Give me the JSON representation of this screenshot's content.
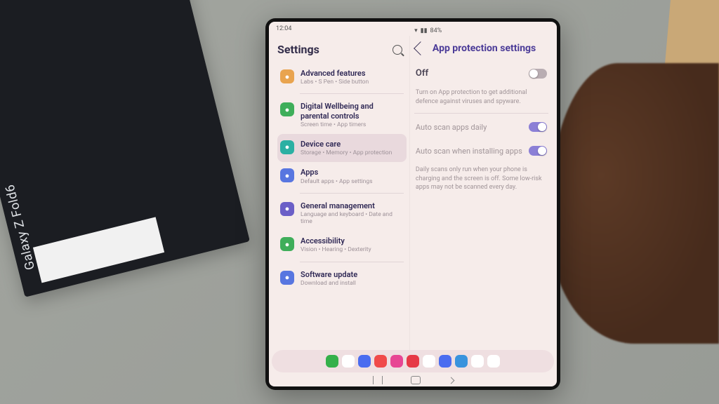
{
  "device_label": "Galaxy Z Fold6",
  "status": {
    "time": "12:04",
    "battery": "84%"
  },
  "left_pane": {
    "title": "Settings",
    "items": [
      {
        "title": "Advanced features",
        "sub": "Labs • S Pen • Side button",
        "icon": "ic-orange"
      },
      {
        "title": "Digital Wellbeing and parental controls",
        "sub": "Screen time • App timers",
        "icon": "ic-green"
      },
      {
        "title": "Device care",
        "sub": "Storage • Memory • App protection",
        "icon": "ic-teal",
        "selected": true
      },
      {
        "title": "Apps",
        "sub": "Default apps • App settings",
        "icon": "ic-blue"
      },
      {
        "title": "General management",
        "sub": "Language and keyboard • Date and time",
        "icon": "ic-purple"
      },
      {
        "title": "Accessibility",
        "sub": "Vision • Hearing • Dexterity",
        "icon": "ic-green2"
      },
      {
        "title": "Software update",
        "sub": "Download and install",
        "icon": "ic-blue"
      }
    ]
  },
  "right_pane": {
    "title": "App protection settings",
    "master": {
      "label": "Off",
      "on": false
    },
    "desc1": "Turn on App protection to get additional defence against viruses and spyware.",
    "opts": [
      {
        "label": "Auto scan apps daily",
        "on": true
      },
      {
        "label": "Auto scan when installing apps",
        "on": true
      }
    ],
    "desc2": "Daily scans only run when your phone is charging and the screen is off. Some low-risk apps may not be scanned every day."
  },
  "dock_colors": [
    "#34b04a",
    "#fff",
    "#4a6cf0",
    "#f04a4a",
    "#e74694",
    "#e63946",
    "#fff",
    "#4a6cf0",
    "#3993dd",
    "#fff",
    "#fff"
  ]
}
